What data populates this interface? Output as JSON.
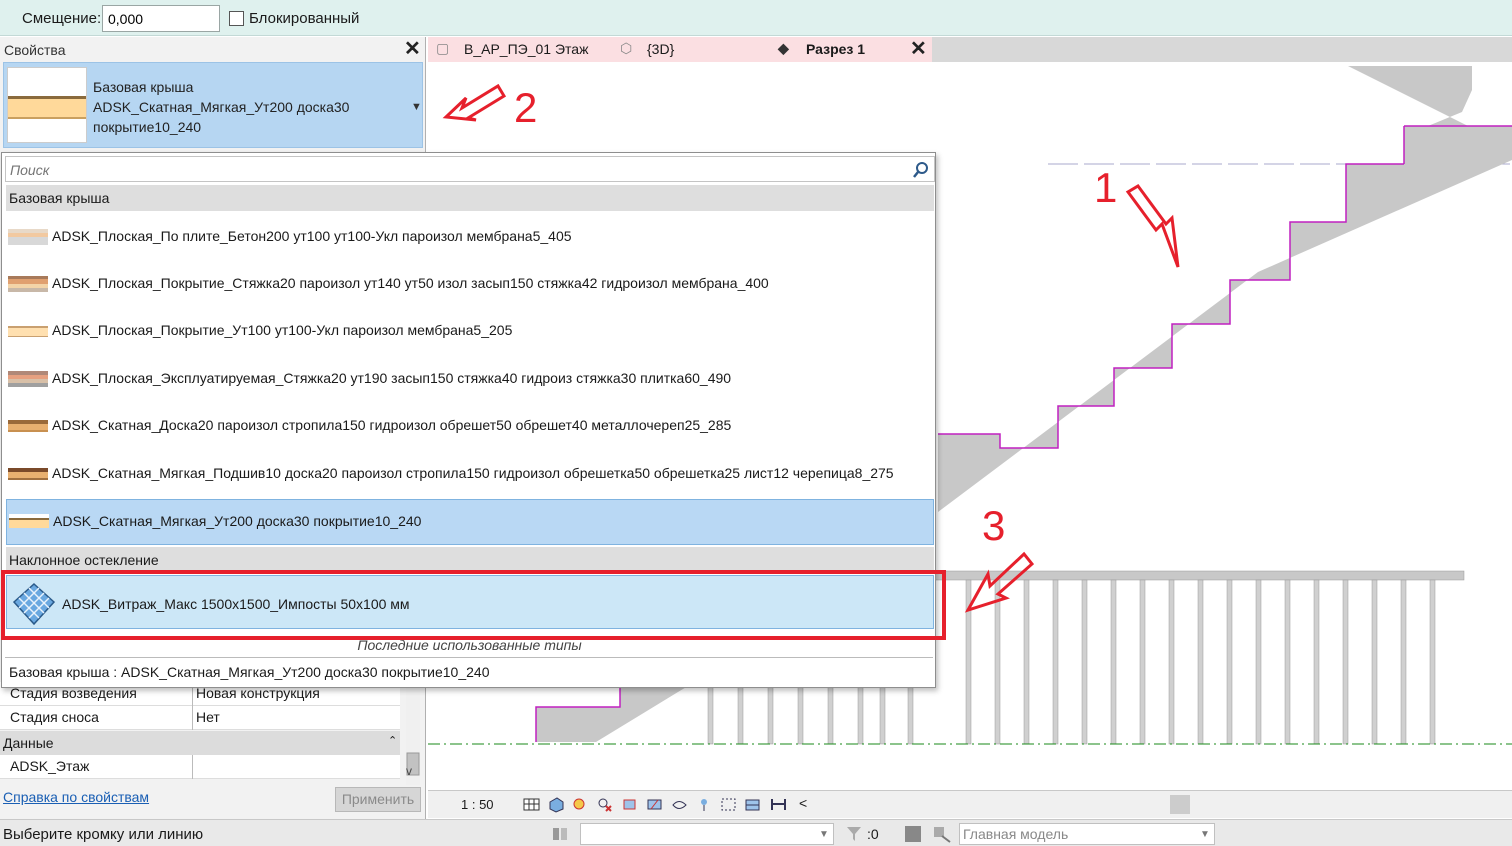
{
  "options_bar": {
    "offset_label": "Смещение:",
    "offset_value": "0,000",
    "locked_label": "Блокированный"
  },
  "properties": {
    "title": "Свойства",
    "type_family": "Базовая крыша",
    "type_name_line1": "ADSK_Скатная_Мягкая_Ут200 доска30",
    "type_name_line2": "покрытие10_240",
    "rows": [
      {
        "key": "Стадия возведения",
        "value": "Новая конструкция"
      },
      {
        "key": "Стадия сноса",
        "value": "Нет"
      }
    ],
    "group_data": "Данные",
    "row_floor_key": "ADSK_Этаж",
    "help_link": "Справка по свойствам",
    "apply_button": "Применить"
  },
  "tabs": [
    {
      "label": "В_АР_ПЭ_01 Этаж",
      "icon": "floor-plan-icon"
    },
    {
      "label": "{3D}",
      "icon": "3d-view-icon"
    },
    {
      "label": "Разрез 1",
      "icon": "section-icon",
      "active": true
    }
  ],
  "dropdown": {
    "search_placeholder": "Поиск",
    "group_roof": "Базовая крыша",
    "roof_items": [
      {
        "label": "ADSK_Плоская_По плите_Бетон200 ут100 ут100-Укл пароизол мембрана5_405"
      },
      {
        "label": "ADSK_Плоская_Покрытие_Стяжка20 пароизол ут140 ут50 изол засып150 стяжка42 гидроизол мембрана_400"
      },
      {
        "label": "ADSK_Плоская_Покрытие_Ут100 ут100-Укл пароизол мембрана5_205"
      },
      {
        "label": "ADSK_Плоская_Эксплуатируемая_Стяжка20 ут190 засып150 стяжка40 гидроиз стяжка30 плитка60_490"
      },
      {
        "label": "ADSK_Скатная_Доска20 пароизол стропила150 гидроизол обрешет50 обрешет40 металлочереп25_285"
      },
      {
        "label": "ADSK_Скатная_Мягкая_Подшив10 доска20 пароизол стропила150 гидроизол обрешетка50 обрешетка25 лист12 черепица8_275"
      },
      {
        "label": "ADSK_Скатная_Мягкая_Ут200 доска30 покрытие10_240",
        "selected": true
      }
    ],
    "group_glazing": "Наклонное остекление",
    "glazing_item": "ADSK_Витраж_Макс 1500x1500_Импосты 50x100 мм",
    "recent_label": "Последние использованные типы",
    "recent_item": "Базовая крыша : ADSK_Скатная_Мягкая_Ут200 доска30 покрытие10_240"
  },
  "annotations": {
    "n1": "1",
    "n2": "2",
    "n3": "3",
    "color": "#e6202c"
  },
  "view_control": {
    "scale": "1 : 50"
  },
  "status_bar": {
    "prompt": "Выберите кромку или линию",
    "filter_count": ":0",
    "active_model": "Главная модель"
  },
  "colors": {
    "options_bar_bg": "#dff1ee",
    "selection_blue": "#b9d8f4",
    "tab_bg": "#fbdfe2",
    "stair_fill": "#c8c8c8",
    "stair_edge": "#c020c0"
  }
}
